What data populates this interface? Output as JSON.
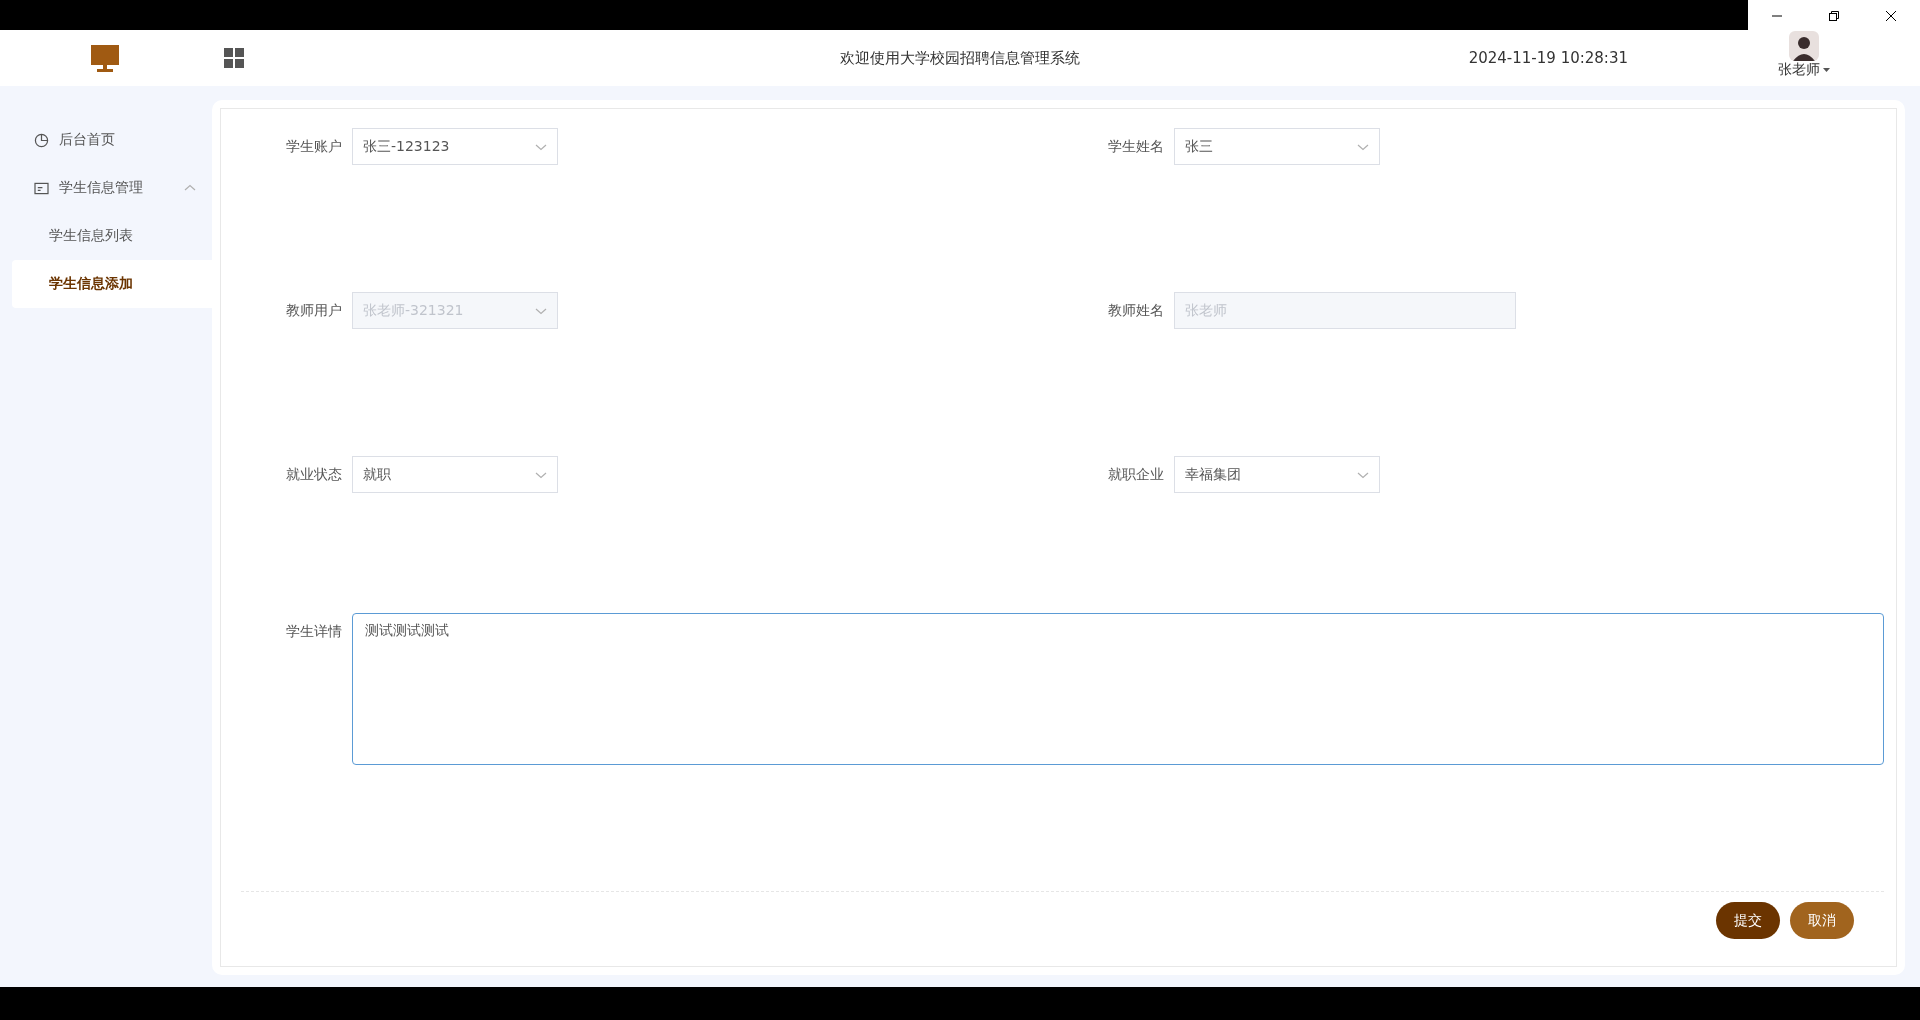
{
  "header": {
    "title": "欢迎使用大学校园招聘信息管理系统",
    "datetime": "2024-11-19 10:28:31",
    "user": "张老师"
  },
  "sidebar": {
    "items": [
      {
        "label": "后台首页",
        "selected": false
      },
      {
        "label": "学生信息管理",
        "expanded": true,
        "selected": false,
        "children": [
          {
            "label": "学生信息列表",
            "selected": false
          },
          {
            "label": "学生信息添加",
            "selected": true
          }
        ]
      }
    ]
  },
  "form": {
    "rows": [
      [
        {
          "label": "学生账户",
          "kind": "select",
          "value": "张三-123123",
          "disabled": false
        },
        {
          "label": "学生姓名",
          "kind": "select",
          "value": "张三",
          "disabled": false
        }
      ],
      [
        {
          "label": "教师用户",
          "kind": "select",
          "value": "张老师-321321",
          "disabled": true
        },
        {
          "label": "教师姓名",
          "kind": "input",
          "value": "张老师",
          "disabled": true
        }
      ],
      [
        {
          "label": "就业状态",
          "kind": "select",
          "value": "就职",
          "disabled": false
        },
        {
          "label": "就职企业",
          "kind": "select",
          "value": "幸福集团",
          "disabled": false
        }
      ]
    ],
    "details": {
      "label": "学生详情",
      "value": "测试测试测试"
    },
    "buttons": [
      {
        "label": "提交",
        "kind": "primary"
      },
      {
        "label": "取消",
        "kind": "secondary"
      }
    ]
  }
}
